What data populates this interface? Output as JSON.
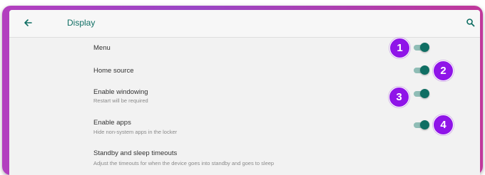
{
  "header": {
    "title": "Display"
  },
  "settings": [
    {
      "title": "Menu",
      "subtitle": "",
      "toggle_on": true,
      "badge": "1"
    },
    {
      "title": "Home source",
      "subtitle": "",
      "toggle_on": true,
      "badge": "2"
    },
    {
      "title": "Enable windowing",
      "subtitle": "Restart will be required",
      "toggle_on": true,
      "badge": "3"
    },
    {
      "title": "Enable apps",
      "subtitle": "Hide non-system apps in the locker",
      "toggle_on": true,
      "badge": "4"
    },
    {
      "title": "Standby and sleep timeouts",
      "subtitle": "Adjust the timeouts for when the device goes into standby and goes to sleep"
    }
  ],
  "icons": {
    "back": "arrow-back-icon",
    "search": "search-icon"
  },
  "colors": {
    "accent": "#0f6e63",
    "badge": "#8f14e8",
    "frame": "#b33fbf"
  }
}
